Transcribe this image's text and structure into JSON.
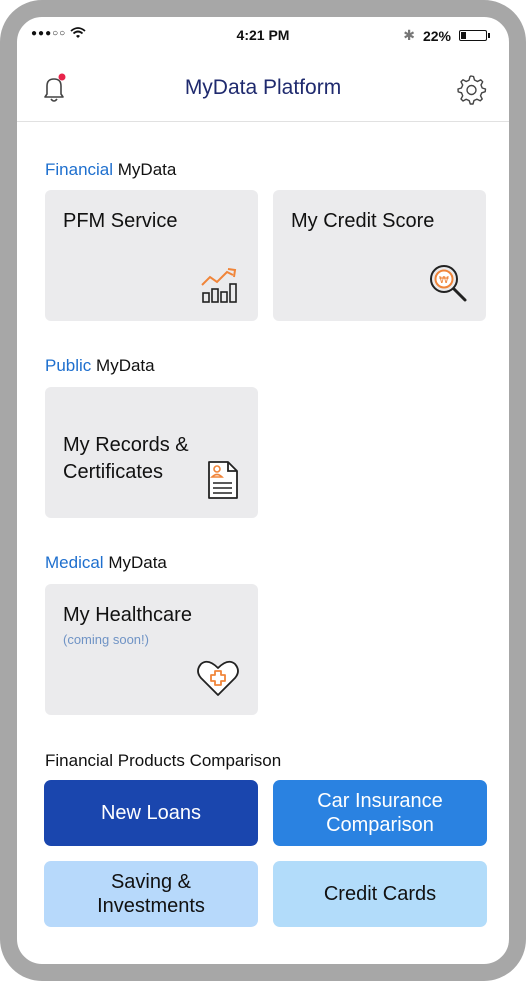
{
  "status_bar": {
    "signal": "●●●○○",
    "time": "4:21 PM",
    "bluetooth": "✱",
    "battery_text": "22%",
    "battery_level": 0.22
  },
  "header": {
    "title": "MyData Platform",
    "left_icon": "bell-icon",
    "right_icon": "gear-icon",
    "notification_color": "#e8234a"
  },
  "sections": [
    {
      "accent": "Financial",
      "rest": " MyData",
      "cards": [
        {
          "label": "PFM Service",
          "icon": "chart-icon"
        },
        {
          "label": "My Credit Score",
          "icon": "credit-search-icon"
        }
      ]
    },
    {
      "accent": "Public",
      "rest": " MyData",
      "cards": [
        {
          "label": "My Records &\nCertificates",
          "icon": "document-icon"
        }
      ]
    },
    {
      "accent": "Medical",
      "rest": " MyData",
      "cards": [
        {
          "label": "My Healthcare",
          "sub": "(coming soon!)",
          "icon": "heart-plus-icon"
        }
      ]
    }
  ],
  "comparison": {
    "title": "Financial Products Comparison",
    "buttons": [
      {
        "label": "New Loans",
        "bg": "#1a46ae",
        "fg": "#ffffff"
      },
      {
        "label": "Car Insurance\nComparison",
        "bg": "#2a82e1",
        "fg": "#ffffff"
      },
      {
        "label": "Saving &\nInvestments",
        "bg": "#b7d9fb",
        "fg": "#111111"
      },
      {
        "label": "Credit Cards",
        "bg": "#b2dcfa",
        "fg": "#111111"
      }
    ]
  },
  "colors": {
    "accent_text": "#1e6fce",
    "icon_orange": "#f0853a",
    "card_bg": "#ebebed"
  }
}
